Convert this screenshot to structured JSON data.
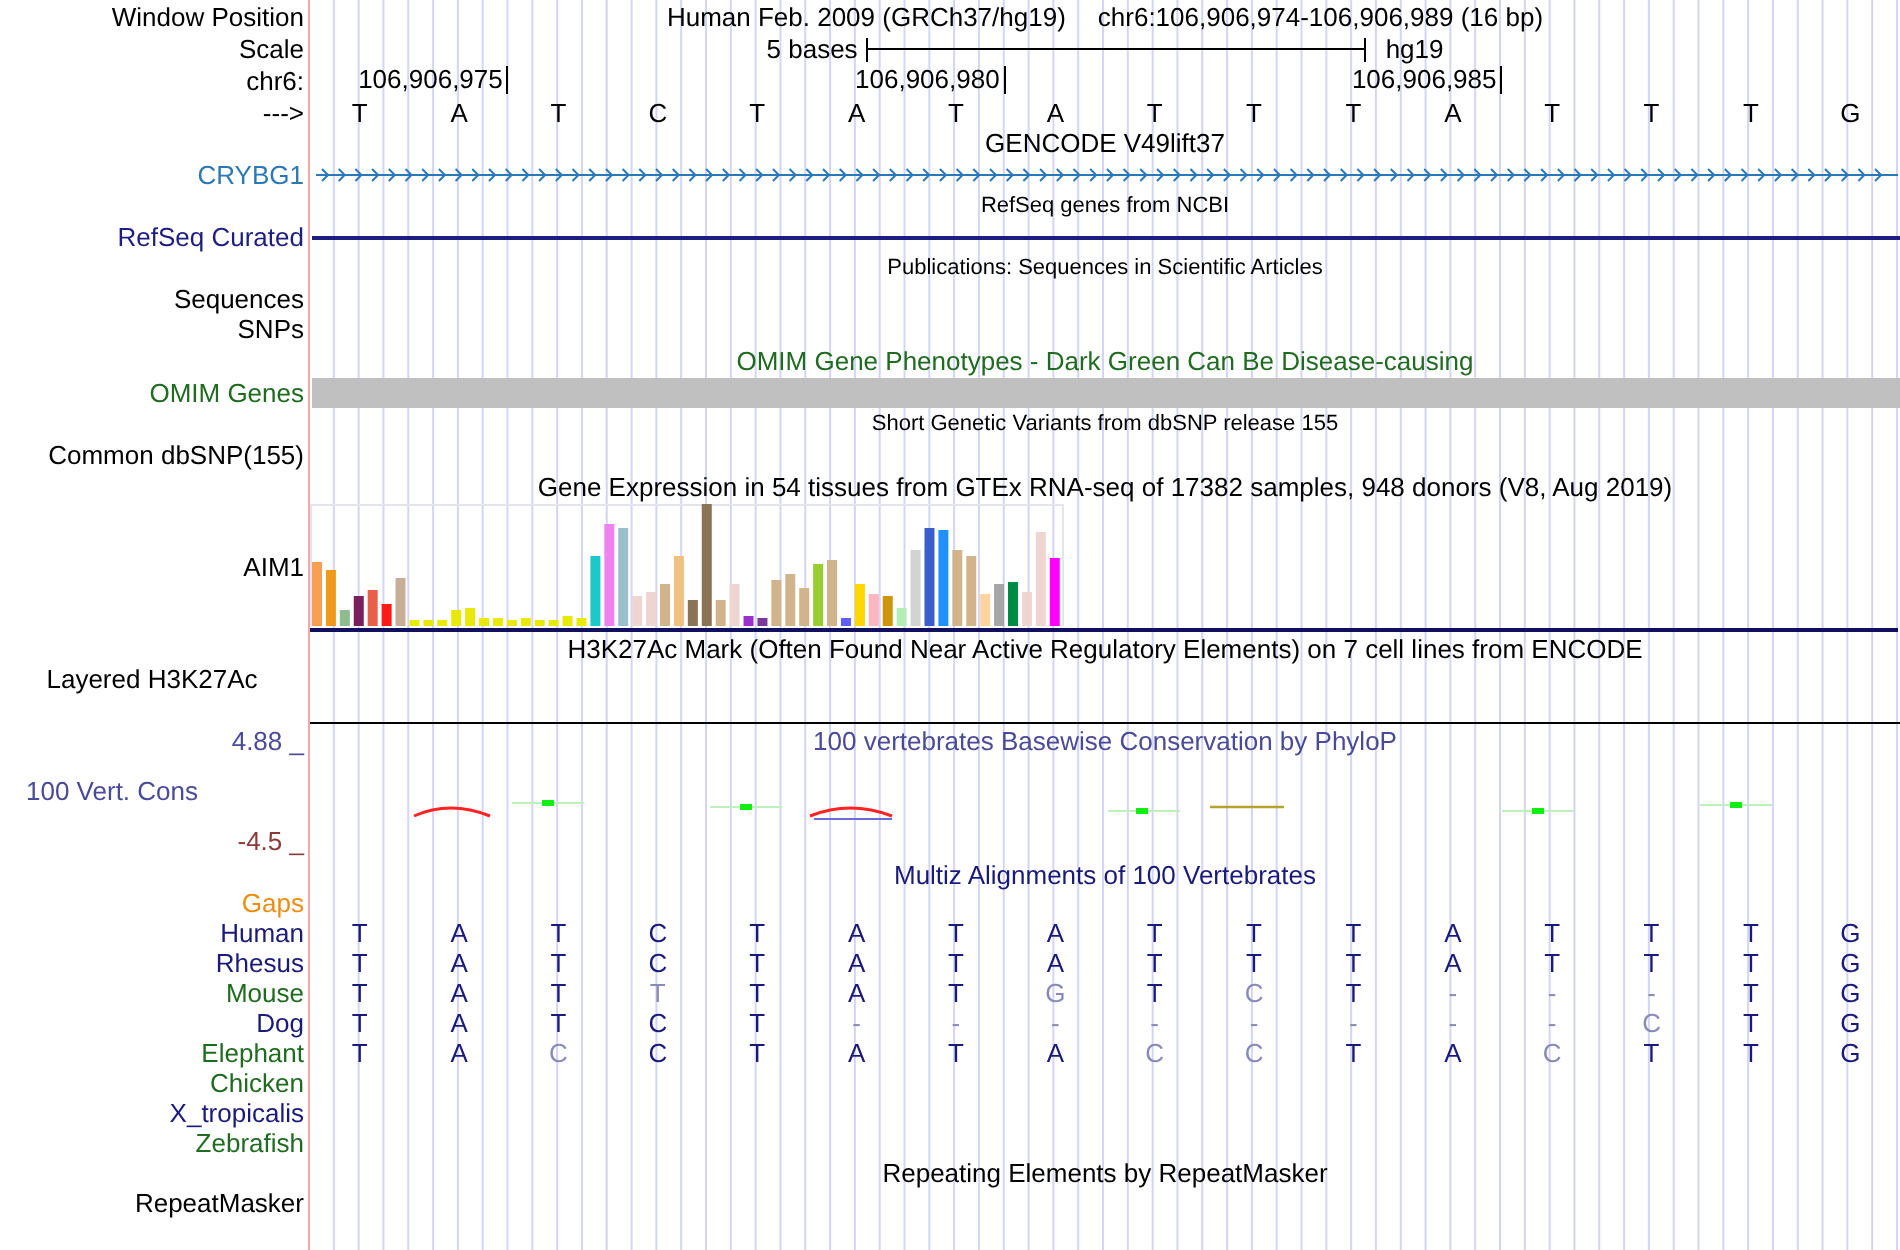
{
  "header": {
    "window_position_label": "Window Position",
    "assembly": "Human Feb. 2009 (GRCh37/hg19)",
    "position": "chr6:106,906,974-106,906,989 (16 bp)",
    "scale_label": "Scale",
    "scale_text": "5 bases",
    "scale_db": "hg19",
    "chrom_label": "chr6:",
    "ticks": [
      "106,906,975",
      "106,906,980",
      "106,906,985"
    ],
    "strand_label": "--->",
    "bases": [
      "T",
      "A",
      "T",
      "C",
      "T",
      "A",
      "T",
      "A",
      "T",
      "T",
      "T",
      "A",
      "T",
      "T",
      "T",
      "G"
    ]
  },
  "tracks": [
    {
      "kind": "gene",
      "title": "GENCODE V49lift37",
      "label": "CRYBG1",
      "color": "#2a78b8"
    },
    {
      "kind": "line",
      "title": "RefSeq genes from NCBI",
      "label": "RefSeq Curated",
      "color": "#1e1e82"
    },
    {
      "kind": "publications",
      "title": "Publications: Sequences in Scientific Articles",
      "labels": [
        "Sequences",
        "SNPs"
      ]
    },
    {
      "kind": "omim",
      "title": "OMIM Gene Phenotypes - Dark Green Can Be Disease-causing",
      "label": "OMIM Genes",
      "color": "#1f6b1f"
    },
    {
      "kind": "snp",
      "title": "Short Genetic Variants from dbSNP release 155",
      "label": "Common dbSNP(155)"
    },
    {
      "kind": "expression",
      "title": "Gene Expression in 54 tissues from GTEx RNA-seq of 17382 samples, 948 donors (V8, Aug 2019)",
      "label": "AIM1"
    },
    {
      "kind": "layered",
      "title": "H3K27Ac Mark (Often Found Near Active Regulatory Elements) on 7 cell lines from ENCODE",
      "label": "Layered H3K27Ac"
    },
    {
      "kind": "conservation",
      "title": "100 vertebrates Basewise Conservation by PhyloP",
      "label": "100 Vert. Cons",
      "color": "#4a4a98",
      "y_max": "4.88 _",
      "y_min": "-4.5 _"
    },
    {
      "kind": "alignment",
      "title": "Multiz Alignments of 100 Vertebrates",
      "color": "#1a1a7a",
      "gaps": {
        "label": "Gaps",
        "color": "#ee8c10"
      },
      "species": [
        {
          "name": "Human",
          "color": "#1a1a7a",
          "bases": [
            "T",
            "A",
            "T",
            "C",
            "T",
            "A",
            "T",
            "A",
            "T",
            "T",
            "T",
            "A",
            "T",
            "T",
            "T",
            "G"
          ]
        },
        {
          "name": "Rhesus",
          "color": "#1a1a7a",
          "bases": [
            "T",
            "A",
            "T",
            "C",
            "T",
            "A",
            "T",
            "A",
            "T",
            "T",
            "T",
            "A",
            "T",
            "T",
            "T",
            "G"
          ]
        },
        {
          "name": "Mouse",
          "color": "#1f6b1f",
          "bases": [
            "T",
            "A",
            "T",
            "T",
            "T",
            "A",
            "T",
            "G",
            "T",
            "C",
            "T",
            "-",
            "-",
            "-",
            "T",
            "G"
          ]
        },
        {
          "name": "Dog",
          "color": "#1a1a7a",
          "bases": [
            "T",
            "A",
            "T",
            "C",
            "T",
            "-",
            "-",
            "-",
            "-",
            "-",
            "-",
            "-",
            "-",
            "C",
            "T",
            "G"
          ]
        },
        {
          "name": "Elephant",
          "color": "#1f6b1f",
          "bases": [
            "T",
            "A",
            "C",
            "C",
            "T",
            "A",
            "T",
            "A",
            "C",
            "C",
            "T",
            "A",
            "C",
            "T",
            "T",
            "G"
          ]
        },
        {
          "name": "Chicken",
          "color": "#1f6b1f"
        },
        {
          "name": "X_tropicalis",
          "color": "#1a1a7a"
        },
        {
          "name": "Zebrafish",
          "color": "#1f6b1f"
        }
      ]
    },
    {
      "kind": "repeat",
      "title": "Repeating Elements by RepeatMasker",
      "label": "RepeatMasker"
    }
  ]
}
